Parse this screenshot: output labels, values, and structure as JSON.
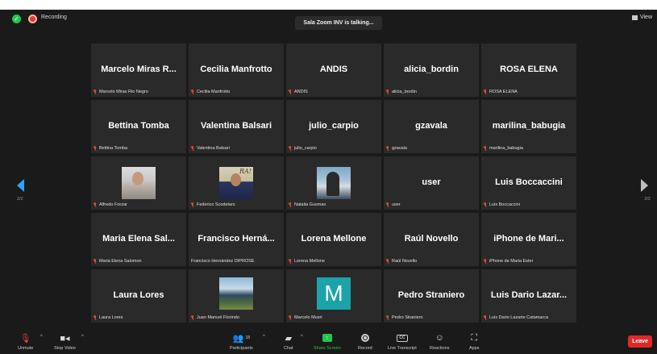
{
  "topbar": {
    "recording_label": "Recording",
    "speaker_label": "Sala Zoom INV is talking...",
    "view_label": "View"
  },
  "pagination": {
    "left": "2/2",
    "right": "2/2"
  },
  "tiles": [
    {
      "display": "Marcelo Miras R...",
      "caption": "Marcelo Miras Rio Negro",
      "muted": true
    },
    {
      "display": "Cecilia Manfrotto",
      "caption": "Cecilia Manfrotto",
      "muted": true
    },
    {
      "display": "ANDIS",
      "caption": "ANDIS",
      "muted": true
    },
    {
      "display": "alicia_bordin",
      "caption": "alicia_bordin",
      "muted": true
    },
    {
      "display": "ROSA ELENA",
      "caption": "ROSA ELENA",
      "muted": true
    },
    {
      "display": "Bettina Tomba",
      "caption": "Bettina Tomba",
      "muted": true
    },
    {
      "display": "Valentina Balsari",
      "caption": "Valentina Balsari",
      "muted": true
    },
    {
      "display": "julio_carpio",
      "caption": "julio_carpio",
      "muted": true
    },
    {
      "display": "gzavala",
      "caption": "gzavala",
      "muted": true
    },
    {
      "display": "marilina_babugia",
      "caption": "marilina_babugia",
      "muted": true
    },
    {
      "display": "",
      "caption": "Alfredo Forzar",
      "muted": true,
      "avatar": "photo1"
    },
    {
      "display": "",
      "caption": "Federico Scodelaro",
      "muted": true,
      "avatar": "photo2",
      "avatar_text": "RA!"
    },
    {
      "display": "",
      "caption": "Natalia Gusman",
      "muted": true,
      "avatar": "photo3"
    },
    {
      "display": "user",
      "caption": "user",
      "muted": true
    },
    {
      "display": "Luis Boccaccini",
      "caption": "Luis Boccaccini",
      "muted": true
    },
    {
      "display": "Maria Elena Sal...",
      "caption": "Maria Elena Salomon",
      "muted": true
    },
    {
      "display": "Francisco Herná...",
      "caption": "Francisco Hernández DIPROSE",
      "muted": false
    },
    {
      "display": "Lorena Mellone",
      "caption": "Lorena Mellone",
      "muted": true
    },
    {
      "display": "Raúl Novello",
      "caption": "Raúl Novello",
      "muted": true
    },
    {
      "display": "iPhone de Mari...",
      "caption": "iPhone de Maria Ester",
      "muted": true
    },
    {
      "display": "Laura Lores",
      "caption": "Laura Lores",
      "muted": true
    },
    {
      "display": "",
      "caption": "Juan Manuel Florindo",
      "muted": true,
      "avatar": "photo4"
    },
    {
      "display": "",
      "caption": "Marcelo Musri",
      "muted": true,
      "avatar": "letter",
      "avatar_text": "M"
    },
    {
      "display": "Pedro Straniero",
      "caption": "Pedro Straniero",
      "muted": true
    },
    {
      "display": "Luis Dario Lazar...",
      "caption": "Luis Dario Lazarte Catamarca",
      "muted": true
    }
  ],
  "toolbar": {
    "unmute": "Unmute",
    "stop_video": "Stop Video",
    "participants": "Participants",
    "participants_count": "18",
    "chat": "Chat",
    "share_screen": "Share Screen",
    "record": "Record",
    "live_transcript": "Live Transcript",
    "reactions": "Reactions",
    "apps": "Apps",
    "leave": "Leave"
  },
  "colors": {
    "background": "#1a1a1a",
    "tile": "#2a2a2a",
    "accent_green": "#23c552",
    "leave_red": "#e02828",
    "nav_blue": "#2aa4ff"
  }
}
